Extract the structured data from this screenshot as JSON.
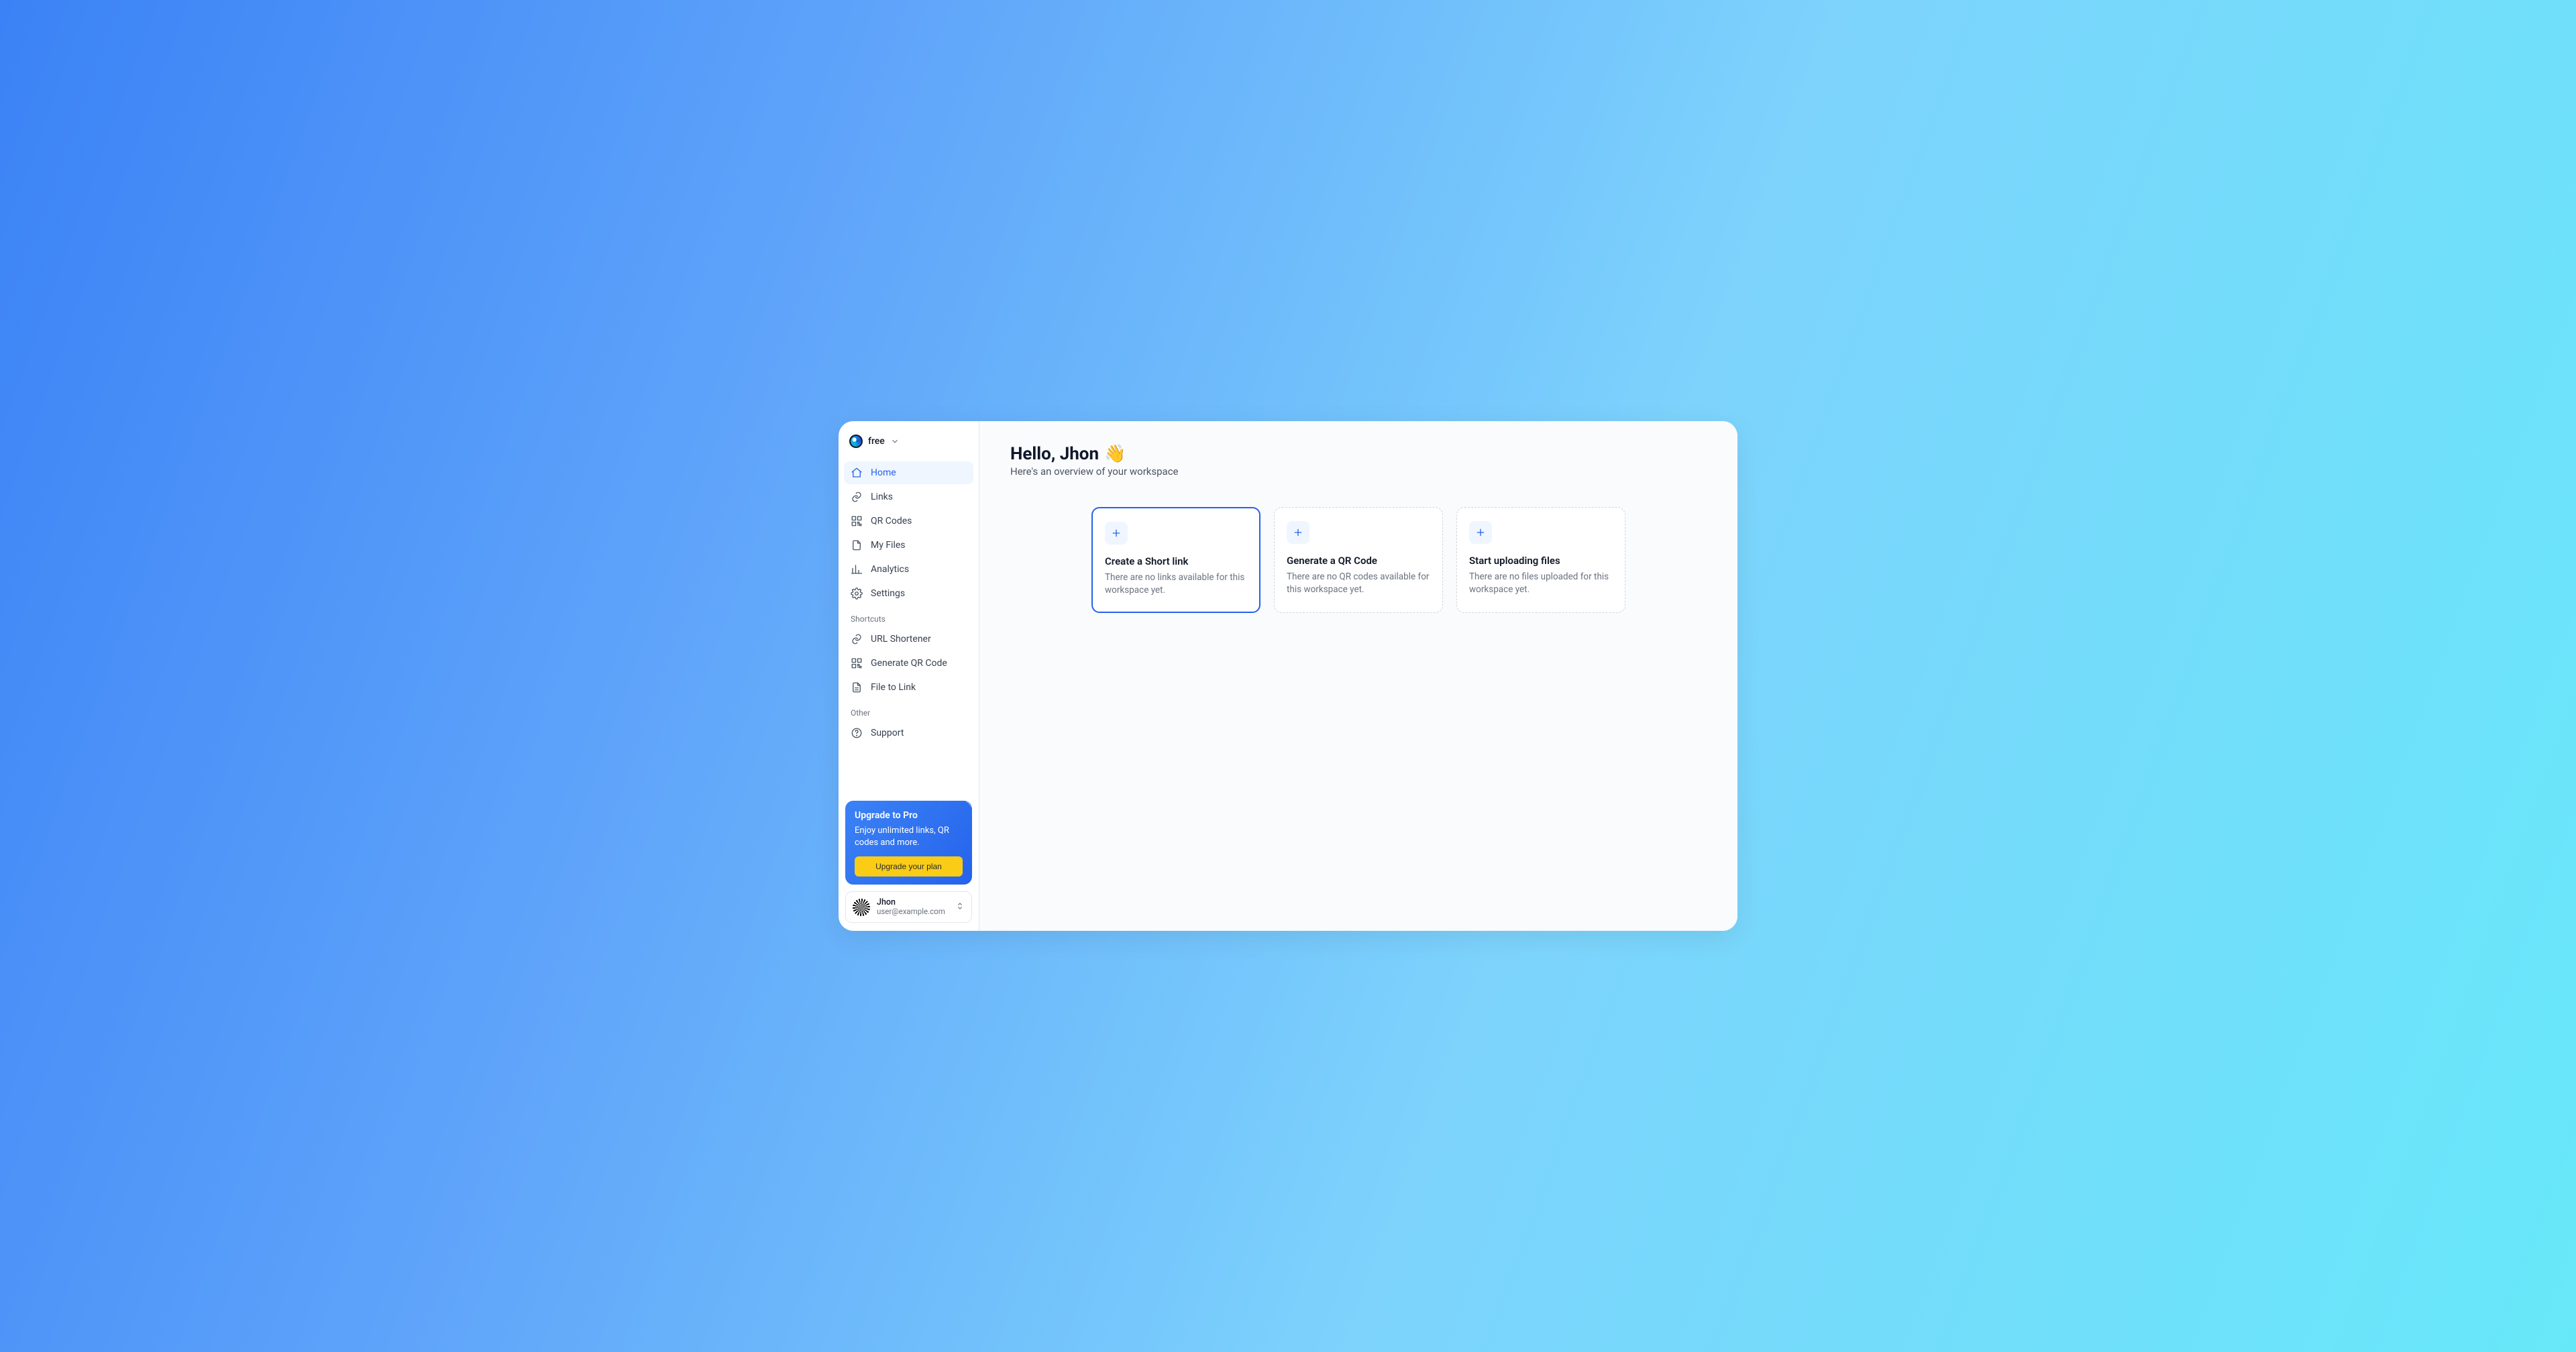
{
  "workspace": {
    "plan": "free"
  },
  "nav": {
    "main": [
      {
        "id": "home",
        "label": "Home",
        "icon": "home",
        "active": true
      },
      {
        "id": "links",
        "label": "Links",
        "icon": "link",
        "active": false
      },
      {
        "id": "qr",
        "label": "QR Codes",
        "icon": "qr",
        "active": false
      },
      {
        "id": "files",
        "label": "My Files",
        "icon": "file",
        "active": false
      },
      {
        "id": "analytics",
        "label": "Analytics",
        "icon": "bars",
        "active": false
      },
      {
        "id": "settings",
        "label": "Settings",
        "icon": "gear",
        "active": false
      }
    ],
    "shortcuts_label": "Shortcuts",
    "shortcuts": [
      {
        "id": "shortener",
        "label": "URL Shortener",
        "icon": "link"
      },
      {
        "id": "genqr",
        "label": "Generate QR Code",
        "icon": "qr"
      },
      {
        "id": "filelink",
        "label": "File to Link",
        "icon": "filetext"
      }
    ],
    "other_label": "Other",
    "other": [
      {
        "id": "support",
        "label": "Support",
        "icon": "help"
      }
    ]
  },
  "upgrade": {
    "title": "Upgrade to Pro",
    "desc": "Enjoy unlimited links, QR codes and more.",
    "cta": "Upgrade your plan"
  },
  "user": {
    "name": "Jhon",
    "email": "user@example.com"
  },
  "main": {
    "greeting_prefix": "Hello, ",
    "greeting_name": "Jhon",
    "greeting_emoji": "👋",
    "subtitle": "Here's an overview of your workspace",
    "cards": [
      {
        "id": "shortlink",
        "title": "Create a Short link",
        "desc": "There are no links available for this workspace yet.",
        "active": true
      },
      {
        "id": "genqr",
        "title": "Generate a QR Code",
        "desc": "There are no QR codes available for this workspace yet.",
        "active": false
      },
      {
        "id": "upload",
        "title": "Start uploading files",
        "desc": "There are no files uploaded for this workspace yet.",
        "active": false
      }
    ]
  }
}
